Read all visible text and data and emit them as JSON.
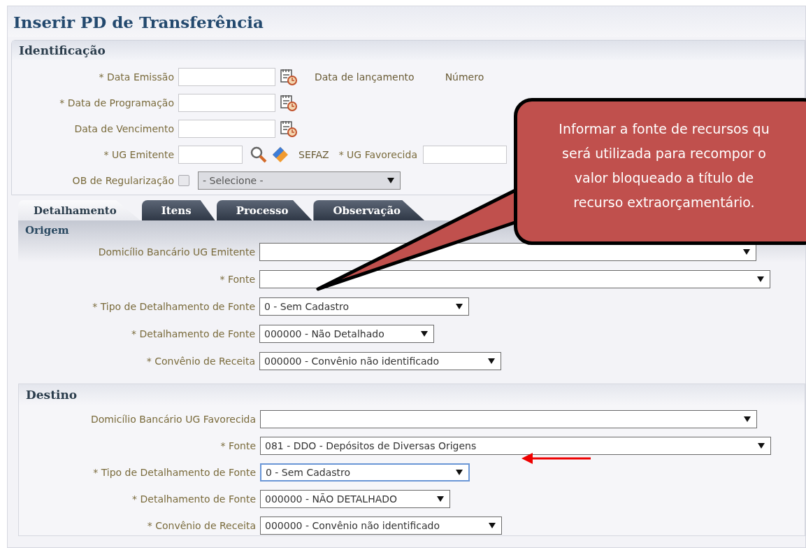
{
  "window": {
    "title": "Inserir PD de Transferência"
  },
  "identificacao": {
    "title": "Identificação",
    "rows": [
      {
        "kind": "date",
        "label": "* Data Emissão",
        "extras": [
          "Data de lançamento",
          "Número"
        ]
      },
      {
        "kind": "date",
        "label": "* Data de Programação"
      },
      {
        "kind": "date",
        "label": "Data de Vencimento"
      },
      {
        "kind": "ug",
        "label": "* UG Emitente",
        "org": "SEFAZ",
        "label2": "* UG Favorecida"
      },
      {
        "kind": "check-select",
        "label": "OB de Regularização",
        "checked": false,
        "select": {
          "value": "- Selecione -",
          "disabled": true
        }
      }
    ]
  },
  "tabs": [
    {
      "label": "Detalhamento",
      "selected": true
    },
    {
      "label": "Itens",
      "selected": false
    },
    {
      "label": "Processo",
      "selected": false
    },
    {
      "label": "Observação",
      "selected": false
    }
  ],
  "origem": {
    "title": "Origem",
    "fields": [
      {
        "label": "Domicílio Bancário UG Emitente",
        "focused": false
      },
      {
        "label": "* Fonte",
        "focused": false
      },
      {
        "label": "* Tipo de Detalhamento de Fonte",
        "value": "0 - Sem Cadastro",
        "focused": false
      },
      {
        "label": "* Detalhamento de Fonte",
        "value": "000000 - Não Detalhado",
        "focused": false
      },
      {
        "label": "* Convênio de Receita",
        "value": "000000 - Convênio não identificado",
        "focused": false
      }
    ]
  },
  "destino": {
    "title": "Destino",
    "fields": [
      {
        "label": "Domicílio Bancário UG Favorecida",
        "focused": false
      },
      {
        "label": "* Fonte",
        "value": "081 - DDO - Depósitos de Diversas Origens",
        "focused": false
      },
      {
        "label": "* Tipo de Detalhamento de Fonte",
        "value": "0 - Sem Cadastro",
        "focused": true
      },
      {
        "label": "* Detalhamento de Fonte",
        "value": "000000 - NÃO DETALHADO",
        "focused": false
      },
      {
        "label": "* Convênio de Receita",
        "value": "000000 - Convênio não identificado",
        "focused": false
      }
    ]
  },
  "callout": {
    "lines": [
      "Informar a fonte de recursos qu",
      "será utilizada para recompor o",
      "valor bloqueado a título de",
      "recurso extraorçamentário."
    ]
  }
}
